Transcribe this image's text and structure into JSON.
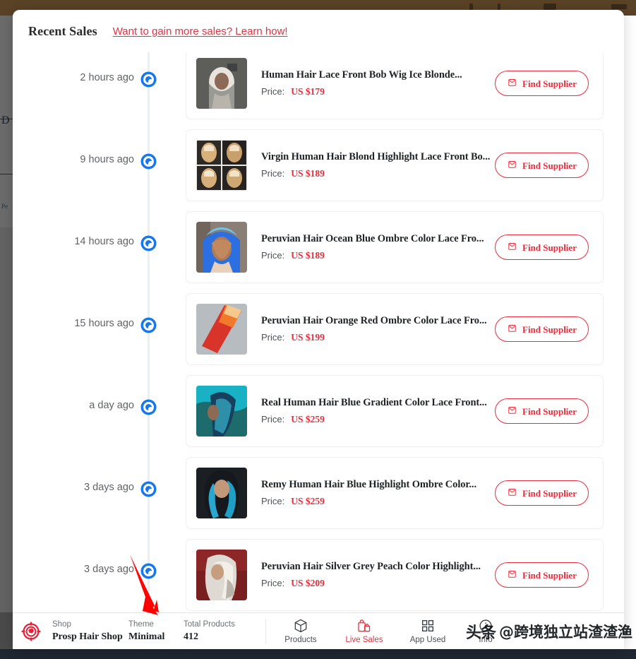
{
  "background": {
    "ghost_text_1": "D",
    "ghost_text_2": "Pe"
  },
  "header": {
    "title": "Recent Sales",
    "learn_more_link": "Want to gain more sales? Learn how!",
    "link_color": "#e8313f"
  },
  "timeline": {
    "axis_color": "#eceff1",
    "dot_color": "#1677ee",
    "entries": [
      {
        "time": "2 hours ago",
        "title": "Human Hair Lace Front Bob Wig Ice Blonde...",
        "price_label": "Price:",
        "price": "US $179",
        "button_label": "Find Supplier",
        "thumb": "blonde-bob-wig"
      },
      {
        "time": "9 hours ago",
        "title": "Virgin Human Hair Blond Highlight Lace Front Bo...",
        "price_label": "Price:",
        "price": "US $189",
        "button_label": "Find Supplier",
        "thumb": "blond-highlight-grid"
      },
      {
        "time": "14 hours ago",
        "title": "Peruvian Hair Ocean Blue Ombre Color Lace Fro...",
        "price_label": "Price:",
        "price": "US $189",
        "button_label": "Find Supplier",
        "thumb": "ocean-blue-wig"
      },
      {
        "time": "15 hours ago",
        "title": "Peruvian Hair Orange Red Ombre Color Lace Fro...",
        "price_label": "Price:",
        "price": "US $199",
        "button_label": "Find Supplier",
        "thumb": "orange-red-ombre"
      },
      {
        "time": "a day ago",
        "title": "Real Human Hair Blue Gradient Color Lace Front...",
        "price_label": "Price:",
        "price": "US $259",
        "button_label": "Find Supplier",
        "thumb": "blue-gradient-wig"
      },
      {
        "time": "3 days ago",
        "title": "Remy Human Hair Blue Highlight Ombre Color...",
        "price_label": "Price:",
        "price": "US $259",
        "button_label": "Find Supplier",
        "thumb": "blue-highlight-ombre"
      },
      {
        "time": "3 days ago",
        "title": "Peruvian Hair Silver Grey Peach Color Highlight...",
        "price_label": "Price:",
        "price": "US $209",
        "button_label": "Find Supplier",
        "thumb": "silver-grey-peach"
      }
    ]
  },
  "bottom_bar": {
    "logo_icon": "target-crosshair-icon",
    "accent_color": "#ee2b3b",
    "stats": [
      {
        "label": "Shop",
        "value": "Prosp Hair Shop"
      },
      {
        "label": "Theme",
        "value": "Minimal"
      },
      {
        "label": "Total Products",
        "value": "412"
      }
    ],
    "nav_items": [
      {
        "label": "Products",
        "icon": "cube-icon",
        "active": false
      },
      {
        "label": "Live Sales",
        "icon": "shopping-bags-icon",
        "active": true
      },
      {
        "label": "App Used",
        "icon": "grid-squares-icon",
        "active": false
      },
      {
        "label": "Info",
        "icon": "info-icon",
        "active": false
      }
    ]
  },
  "watermark": {
    "logo": "头条",
    "handle": "@跨境独立站渣渣渔"
  },
  "annotation": {
    "arrow_color": "#fe0000",
    "points_to": "Theme"
  }
}
